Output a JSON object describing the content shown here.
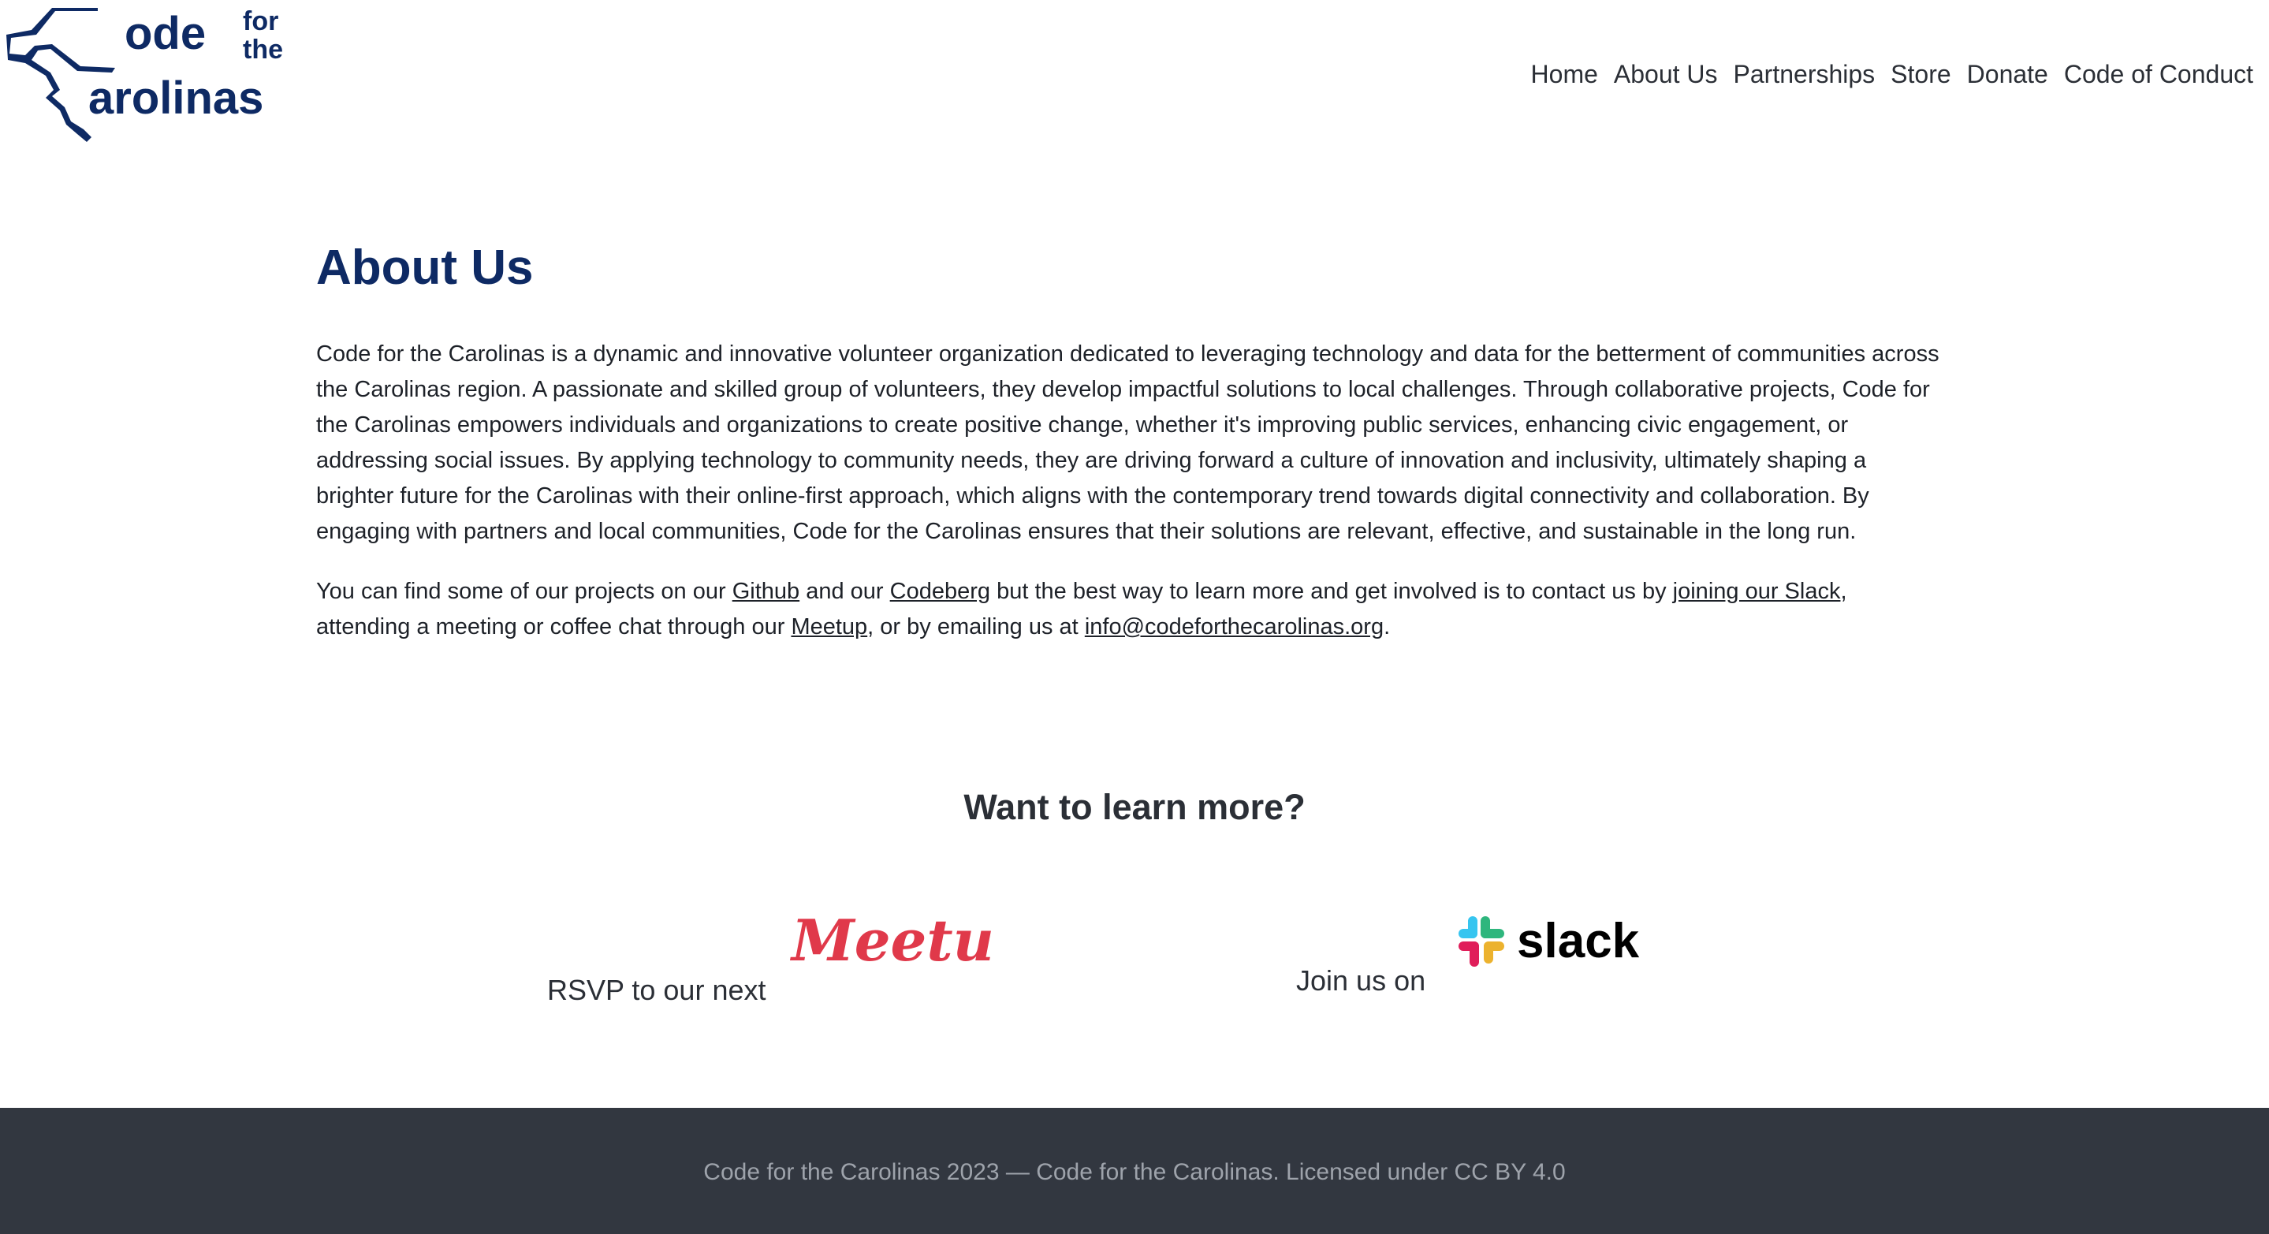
{
  "header": {
    "logo": {
      "alt": "Code for the Carolinas logo",
      "text_code": "ode",
      "text_for": "for",
      "text_the": "the",
      "text_carolinas": "arolinas",
      "color": "#0e2a64"
    },
    "nav": [
      {
        "label": "Home"
      },
      {
        "label": "About Us"
      },
      {
        "label": "Partnerships"
      },
      {
        "label": "Store"
      },
      {
        "label": "Donate"
      },
      {
        "label": "Code of Conduct"
      }
    ]
  },
  "main": {
    "title": "About Us",
    "paragraph1": "Code for the Carolinas is a dynamic and innovative volunteer organization dedicated to leveraging technology and data for the betterment of communities across the Carolinas region. A passionate and skilled group of volunteers, they develop impactful solutions to local challenges. Through collaborative projects, Code for the Carolinas empowers individuals and organizations to create positive change, whether it's improving public services, enhancing civic engagement, or addressing social issues. By applying technology to community needs, they are driving forward a culture of innovation and inclusivity, ultimately shaping a brighter future for the Carolinas with their online-first approach, which aligns with the contemporary trend towards digital connectivity and collaboration. By engaging with partners and local communities, Code for the Carolinas ensures that their solutions are relevant, effective, and sustainable in the long run.",
    "paragraph2": {
      "t1": "You can find some of our projects on our ",
      "link_github": "Github",
      "t2": " and our ",
      "link_codeberg": "Codeberg",
      "t3": " but the best way to learn more and get involved is to contact us by ",
      "link_slack": "joining our Slack",
      "t4": ", attending a meeting or coffee chat through our ",
      "link_meetup": "Meetup",
      "t5": ", or by emailing us at ",
      "link_email": "info@codeforthecarolinas.org",
      "t6": "."
    }
  },
  "learn_more": {
    "heading": "Want to learn more?",
    "rsvp_text": "RSVP to our next",
    "meetup_logo_text": "Meetup",
    "join_text": "Join us on",
    "slack_logo_text": "slack"
  },
  "footer": {
    "text": "Code for the Carolinas 2023 — Code for the Carolinas. Licensed under CC BY 4.0"
  },
  "colors": {
    "brand_navy": "#0e2a64",
    "meetup_red": "#e0394a",
    "footer_bg": "#323740",
    "footer_text": "#9ea3ab"
  }
}
